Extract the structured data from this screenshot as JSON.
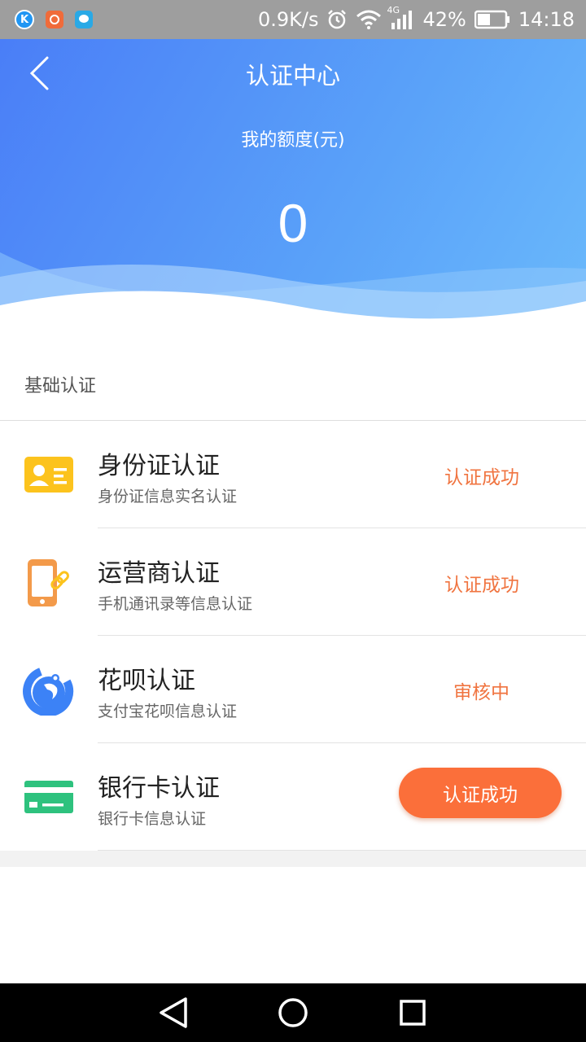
{
  "status_bar": {
    "app_icon_k": "K",
    "network_speed": "0.9K/s",
    "network_type": "4G",
    "battery": "42%",
    "time": "14:18"
  },
  "header": {
    "title": "认证中心",
    "quota_label": "我的额度(元)",
    "quota_value": "0"
  },
  "section": {
    "title": "基础认证"
  },
  "items": [
    {
      "title": "身份证认证",
      "subtitle": "身份证信息实名认证",
      "status": "认证成功",
      "icon": "id-card-icon",
      "color": "#fcc31d"
    },
    {
      "title": "运营商认证",
      "subtitle": "手机通讯录等信息认证",
      "status": "认证成功",
      "icon": "phone-link-icon",
      "color": "#f39a4a"
    },
    {
      "title": "花呗认证",
      "subtitle": "支付宝花呗信息认证",
      "status": "审核中",
      "icon": "huabei-icon",
      "color": "#3c82f6"
    },
    {
      "title": "银行卡认证",
      "subtitle": "银行卡信息认证",
      "status": "认证成功",
      "icon": "bank-card-icon",
      "color": "#2ec27e"
    }
  ],
  "colors": {
    "accent_orange": "#fb6f3a",
    "header_blue": "#4a7ef7"
  }
}
